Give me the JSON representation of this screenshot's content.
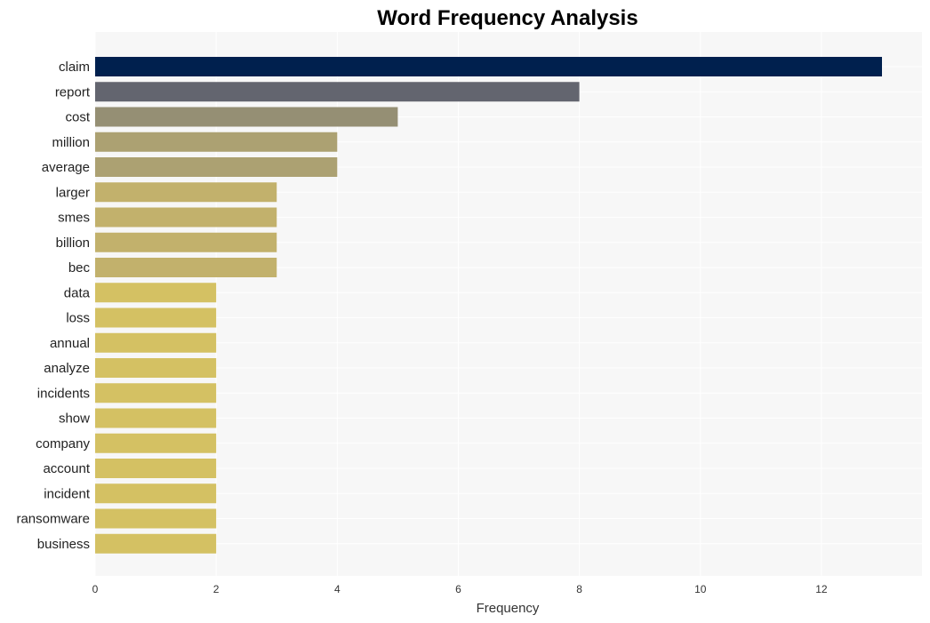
{
  "chart_data": {
    "type": "bar",
    "orientation": "horizontal",
    "title": "Word Frequency Analysis",
    "xlabel": "Frequency",
    "ylabel": "",
    "xlim": [
      0,
      13.6
    ],
    "xticks": [
      0,
      2,
      4,
      6,
      8,
      10,
      12
    ],
    "grid": true,
    "categories": [
      "claim",
      "report",
      "cost",
      "million",
      "average",
      "larger",
      "smes",
      "billion",
      "bec",
      "data",
      "loss",
      "annual",
      "analyze",
      "incidents",
      "show",
      "company",
      "account",
      "incident",
      "ransomware",
      "business"
    ],
    "values": [
      13,
      8,
      5,
      4,
      4,
      3,
      3,
      3,
      3,
      2,
      2,
      2,
      2,
      2,
      2,
      2,
      2,
      2,
      2,
      2
    ],
    "colors": [
      "#00204e",
      "#63656f",
      "#958f74",
      "#aca172",
      "#aca172",
      "#c2b16c",
      "#c2b16c",
      "#c2b16c",
      "#c2b16c",
      "#d4c163",
      "#d4c163",
      "#d4c163",
      "#d4c163",
      "#d4c163",
      "#d4c163",
      "#d4c163",
      "#d4c163",
      "#d4c163",
      "#d4c163",
      "#d4c163"
    ]
  }
}
